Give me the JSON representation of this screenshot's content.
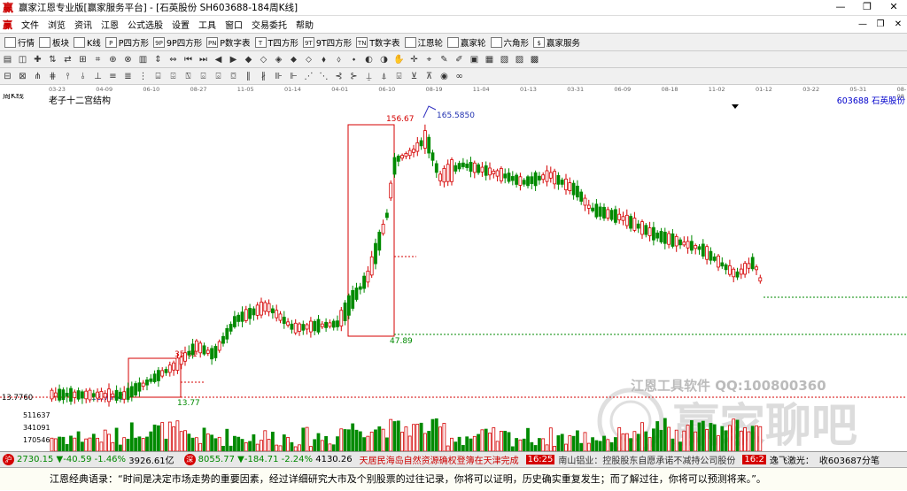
{
  "window": {
    "title": "赢家江恩专业版[赢家服务平台] - [石英股份  SH603688-184周K线]"
  },
  "menu": [
    "文件",
    "浏览",
    "资讯",
    "江恩",
    "公式选股",
    "设置",
    "工具",
    "窗口",
    "交易委托",
    "帮助"
  ],
  "toolbar1": [
    {
      "icon": "grid-icon",
      "label": "行情"
    },
    {
      "icon": "blocks-icon",
      "label": "板块"
    },
    {
      "icon": "kline-icon",
      "label": "K线"
    },
    {
      "icon": "p-square-icon",
      "glyph": "P",
      "label": "P四方形"
    },
    {
      "icon": "9p-square-icon",
      "glyph": "9P",
      "label": "9P四方形"
    },
    {
      "icon": "pn-icon",
      "glyph": "PN",
      "label": "P数字表"
    },
    {
      "icon": "t-square-icon",
      "glyph": "T",
      "label": "T四方形"
    },
    {
      "icon": "9t-square-icon",
      "glyph": "9T",
      "label": "9T四方形"
    },
    {
      "icon": "tn-icon",
      "glyph": "TN",
      "label": "T数字表"
    },
    {
      "icon": "gann-wheel-icon",
      "label": "江恩轮"
    },
    {
      "icon": "winner-wheel-icon",
      "label": "赢家轮"
    },
    {
      "icon": "hexagon-icon",
      "label": "六角形"
    },
    {
      "icon": "dollar-icon",
      "glyph": "$",
      "label": "赢家服务"
    }
  ],
  "chart": {
    "period_label": "周K线",
    "study_label": "老子十二宫结构",
    "code_name": "603688 石英股份",
    "top_dates": [
      "03-23",
      "04-09",
      "06-10",
      "08-27",
      "11-05",
      "01-14",
      "04-01",
      "06-10",
      "08-19",
      "11-04",
      "01-13",
      "03-31",
      "06-09",
      "08-18",
      "11-02",
      "01-12",
      "03-22",
      "05-31",
      "08-08"
    ],
    "annotations": {
      "high_box": "156.67",
      "peak": "165.5850",
      "box_low": "47.89",
      "mid_box_high": "35.61",
      "start_price": "13.7760",
      "start_low": "13.7760",
      "vol_low": "13.77"
    },
    "volume_scale": [
      "511637",
      "341091",
      "170546"
    ],
    "watermark_text": "江恩工具软件 QQ:100800360",
    "watermark_brand": "赢家聊吧",
    "colors": {
      "up": "#d40000",
      "down": "#008a00",
      "box": "#d40000"
    }
  },
  "statusbar": {
    "sh_badge": "沪",
    "sh_index": "2730.15",
    "sh_change": "▼-40.59",
    "sh_pct": "-1.46%",
    "sh_amount": "3926.61亿",
    "sz_badge": "深",
    "sz_index": "8055.77",
    "sz_change": "▼-184.71",
    "sz_pct": "-2.24%",
    "sz_amount": "4130.26",
    "news1": "天居民海岛自然资源确权登簿在天津完成",
    "news_time": "16:25",
    "news2": "南山铝业：控股股东自愿承诺不减持公司股份",
    "news_time2": "16:2",
    "news3": "逸飞激光：",
    "right_text": "收603687分笔"
  },
  "quote": "江恩经典语录：“时间是决定市场走势的重要因素，经过详细研究大市及个别股票的过往记录，你将可以证明，历史确实重复发生；而了解过往，你将可以预测将来。”。"
}
